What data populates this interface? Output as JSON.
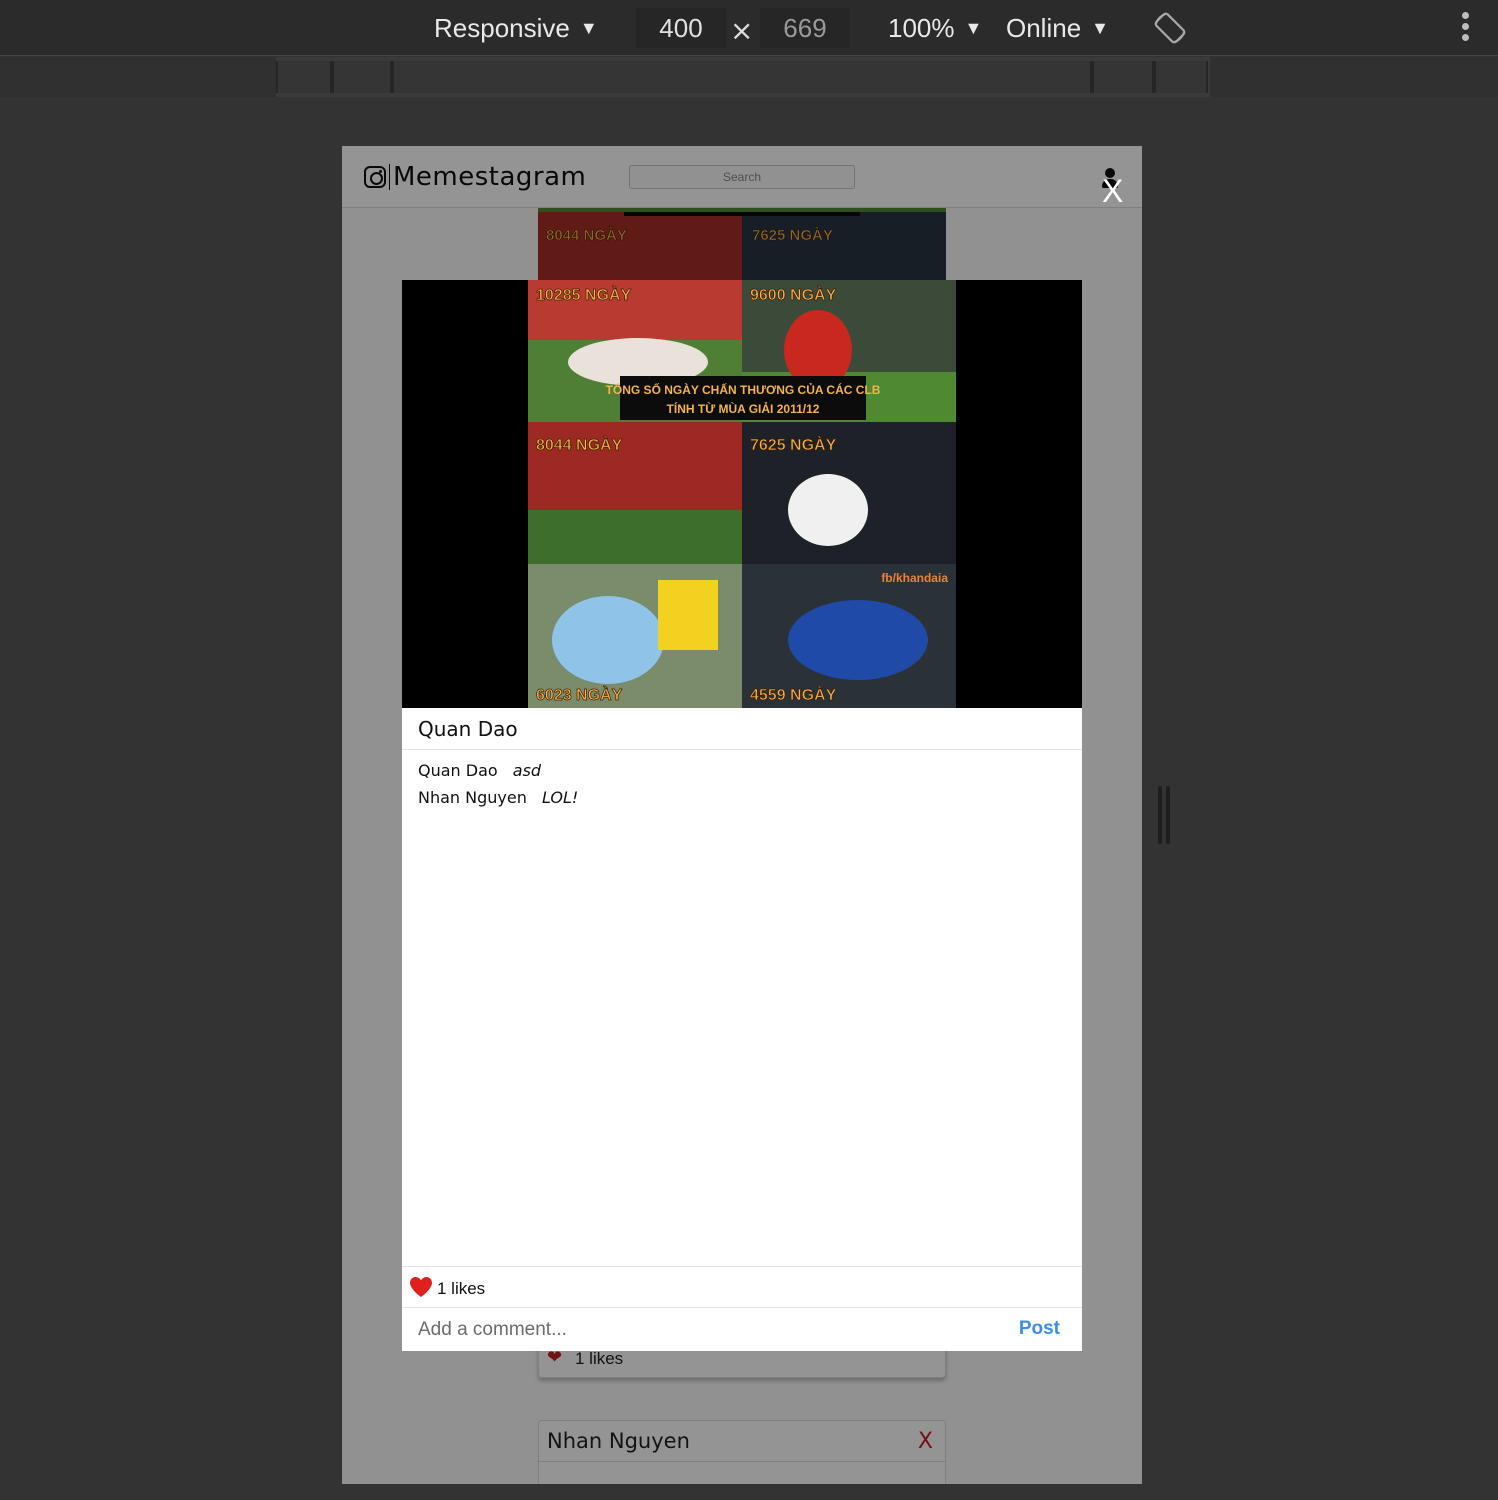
{
  "devtools": {
    "device_mode": "Responsive",
    "width": "400",
    "height": "669",
    "times_symbol": "×",
    "zoom": "100%",
    "network": "Online",
    "dropdown_glyph": "▼",
    "rotate_icon": "rotate-icon",
    "menu_icon": "more-vertical-icon"
  },
  "app": {
    "title": "Memestagram",
    "search_placeholder": "Search",
    "logo_icon": "instagram-icon",
    "profile_icon": "user-icon"
  },
  "modal": {
    "close_label": "X",
    "author": "Quan Dao",
    "comments": [
      {
        "user": "Quan Dao",
        "text": "asd"
      },
      {
        "user": "Nhan Nguyen",
        "text": "LOL!"
      }
    ],
    "likes_text": "1 likes",
    "comment_placeholder": "Add a comment...",
    "post_label": "Post",
    "accent_color": "#3b8ef0",
    "heart_color": "#e0201c"
  },
  "meme": {
    "title_line1": "TỔNG SỐ NGÀY CHẤN THƯƠNG CỦA CÁC CLB",
    "title_line2": "TÍNH TỪ MÙA GIẢI 2011/12",
    "panels": [
      "10285 NGÀY",
      "9600 NGÀY",
      "8044 NGÀY",
      "7625 NGÀY",
      "6023 NGÀY",
      "4559 NGÀY"
    ],
    "credit": "fb/khandaia"
  },
  "background_feed": {
    "likes_text": "1 likes",
    "next_post_author": "Nhan Nguyen",
    "delete_label": "X"
  }
}
